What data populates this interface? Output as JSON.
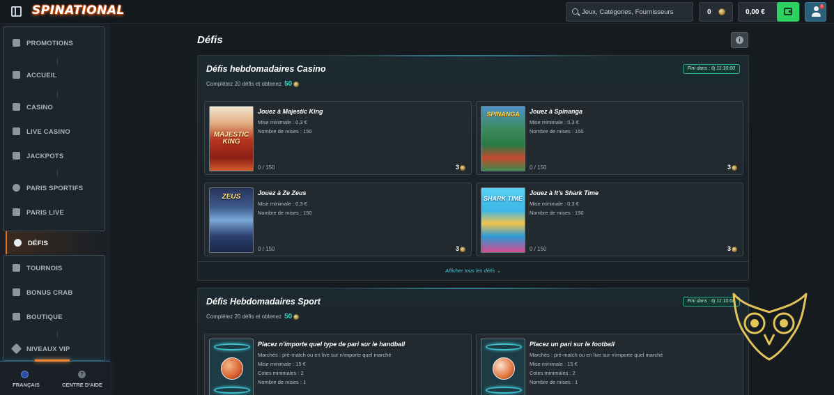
{
  "header": {
    "logo_text": "SPINATIONAL",
    "search_placeholder": "Jeux, Catégories, Fournisseurs",
    "coins": "0",
    "balance": "0,00 €",
    "notifications": "1"
  },
  "sidebar": {
    "groups": [
      {
        "items": [
          {
            "label": "PROMOTIONS",
            "icon": "gift-icon"
          },
          {
            "label": "ACCUEIL",
            "icon": "home-icon"
          }
        ]
      },
      {
        "items": [
          {
            "label": "CASINO",
            "icon": "slot-machine-icon"
          },
          {
            "label": "LIVE CASINO",
            "icon": "cards-icon"
          },
          {
            "label": "JACKPOTS",
            "icon": "jackpot-icon"
          }
        ]
      },
      {
        "items": [
          {
            "label": "PARIS SPORTIFS",
            "icon": "soccer-ball-icon"
          },
          {
            "label": "PARIS LIVE",
            "icon": "live-icon"
          }
        ]
      }
    ],
    "active_item": {
      "label": "DÉFIS",
      "icon": "challenge-icon"
    },
    "groups_after": [
      {
        "label": "TOURNOIS",
        "icon": "trophy-icon"
      },
      {
        "label": "BONUS CRAB",
        "icon": "crab-icon"
      },
      {
        "label": "BOUTIQUE",
        "icon": "shop-bag-icon"
      },
      {
        "label": "NIVEAUX VIP",
        "icon": "diamond-icon"
      }
    ],
    "footer": {
      "language": "FRANÇAIS",
      "help": "CENTRE D'AIDE",
      "help_glyph": "?"
    }
  },
  "main": {
    "title": "Défis",
    "info_glyph": "i",
    "sections": [
      {
        "title": "Défis hebdomadaires Casino",
        "subtitle": "Complétez 20 défis et obtenez",
        "reward": "50",
        "timer": "Fini dans : 6j 11:10:00",
        "cards": [
          {
            "title": "Jouez à Majestic King",
            "line1": "Mise minimale : 0,3 €",
            "line2": "Nombre de mises : 150",
            "progress": "0 / 150",
            "reward": "3",
            "thumb_label": "MAJESTIC KING"
          },
          {
            "title": "Jouez à Spinanga",
            "line1": "Mise minimale : 0,3 €",
            "line2": "Nombre de mises : 150",
            "progress": "0 / 150",
            "reward": "3",
            "thumb_label": "SPINANGA"
          },
          {
            "title": "Jouez à Ze Zeus",
            "line1": "Mise minimale : 0,3 €",
            "line2": "Nombre de mises : 150",
            "progress": "0 / 150",
            "reward": "3",
            "thumb_label": "ZEUS"
          },
          {
            "title": "Jouez à It's Shark Time",
            "line1": "Mise minimale : 0,3 €",
            "line2": "Nombre de mises : 150",
            "progress": "0 / 150",
            "reward": "3",
            "thumb_label": "SHARK TIME"
          }
        ],
        "show_all": "Afficher tous les défis ⌄"
      },
      {
        "title": "Défis Hebdomadaires Sport",
        "subtitle": "Complétez 20 défis et obtenez",
        "reward": "50",
        "timer": "Fini dans : 6j 11:10:00",
        "cards": [
          {
            "title": "Placez n'importe quel type de pari sur le handball",
            "line1": "Marchés : pré-match ou en live sur n'importe quel marché",
            "line2": "Mise minimale : 15 €",
            "line3": "Cotes minimales : 2",
            "line4": "Nombre de mises : 1"
          },
          {
            "title": "Placez un pari sur le football",
            "line1": "Marchés : pré-match ou en live sur n'importe quel marché",
            "line2": "Mise minimale : 15 €",
            "line3": "Cotes minimales : 2",
            "line4": "Nombre de mises : 1"
          }
        ]
      }
    ]
  },
  "colors": {
    "accent_green": "#2ed15f",
    "accent_teal": "#38d8c5",
    "active_orange": "#e2732a",
    "owl_gold": "#e3c45a"
  }
}
